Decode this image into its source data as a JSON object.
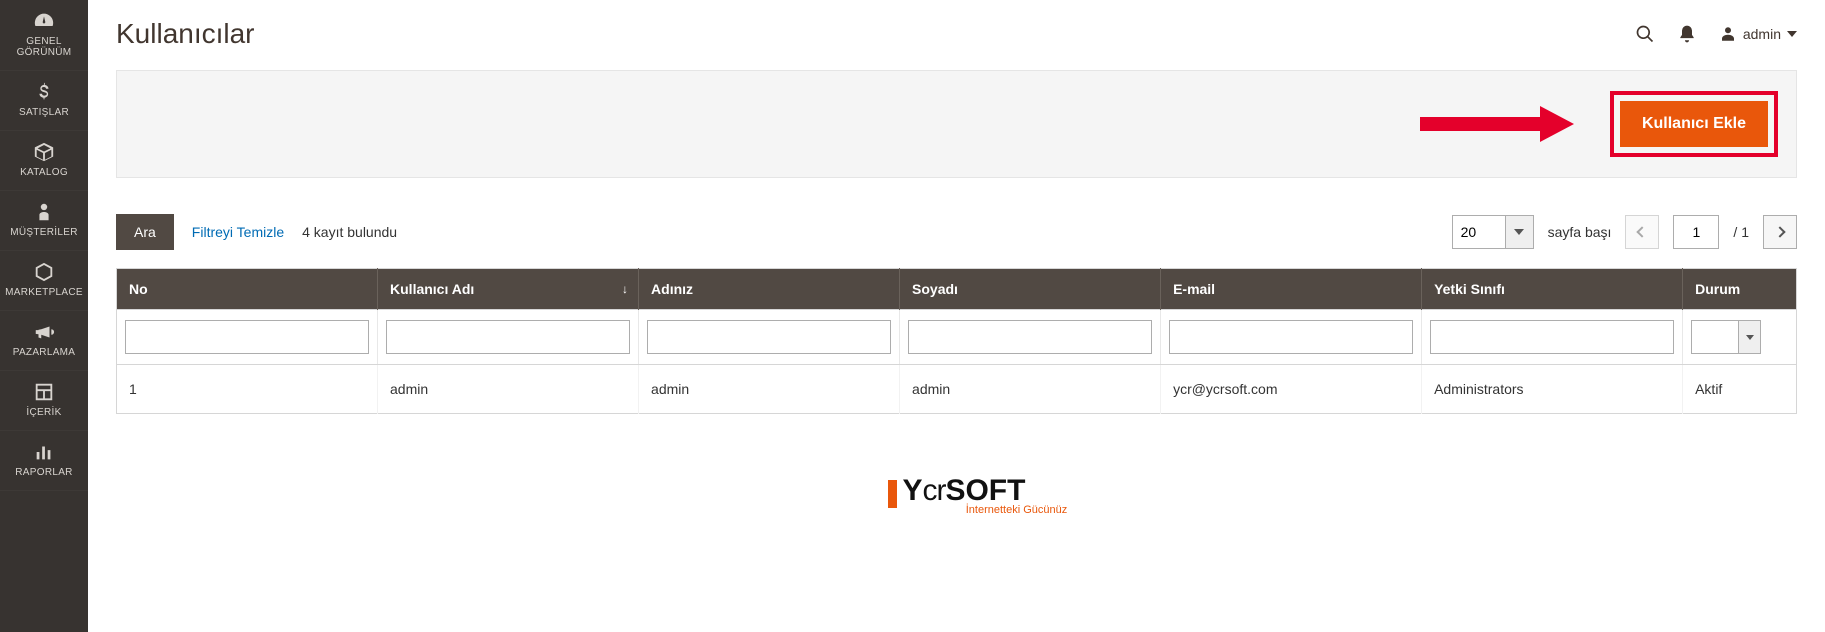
{
  "sidebar": {
    "items": [
      {
        "label": "GENEL GÖRÜNÜM"
      },
      {
        "label": "SATIŞLAR"
      },
      {
        "label": "KATALOG"
      },
      {
        "label": "MÜŞTERİLER"
      },
      {
        "label": "MARKETPLACE"
      },
      {
        "label": "PAZARLAMA"
      },
      {
        "label": "İÇERİK"
      },
      {
        "label": "RAPORLAR"
      }
    ]
  },
  "header": {
    "title": "Kullanıcılar",
    "username": "admin"
  },
  "action": {
    "add_user_label": "Kullanıcı Ekle"
  },
  "toolbar": {
    "search_label": "Ara",
    "reset_label": "Filtreyi Temizle",
    "found_text": "4 kayıt bulundu",
    "page_size_value": "20",
    "per_page_label": "sayfa başı",
    "currentPage": "1",
    "totalPages": "1"
  },
  "table": {
    "headers": {
      "no": "No",
      "username": "Kullanıcı Adı",
      "firstname": "Adınız",
      "lastname": "Soyadı",
      "email": "E-mail",
      "role": "Yetki Sınıfı",
      "status": "Durum"
    },
    "rows": [
      {
        "no": "1",
        "username": "admin",
        "firstname": "admin",
        "lastname": "admin",
        "email": "ycr@ycrsoft.com",
        "role": "Administrators",
        "status": "Aktif"
      }
    ]
  },
  "footer": {
    "brand_prefix": "Y",
    "brand_mid": "cr",
    "brand_suffix": "SOFT",
    "tagline": "İnternetteki Gücünüz"
  }
}
